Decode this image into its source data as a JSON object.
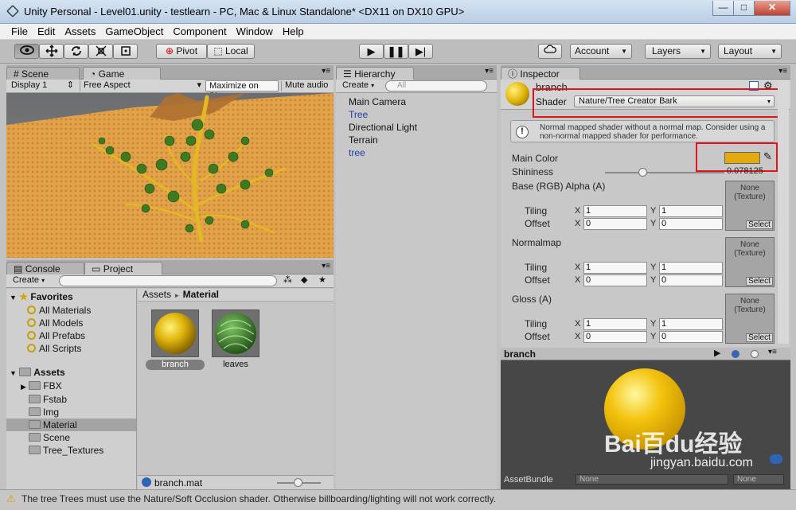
{
  "window": {
    "title": "Unity Personal - Level01.unity - testlearn - PC, Mac & Linux Standalone* <DX11 on DX10 GPU>",
    "btn_min": "—",
    "btn_max": "□",
    "btn_close": "✕"
  },
  "menu": [
    "File",
    "Edit",
    "Assets",
    "GameObject",
    "Component",
    "Window",
    "Help"
  ],
  "toolbar": {
    "pivot": "Pivot",
    "local": "Local",
    "account": "Account",
    "layers": "Layers",
    "layout": "Layout"
  },
  "scene_tabs": {
    "scene": "Scene",
    "game": "Game"
  },
  "game_bar": {
    "display": "Display 1",
    "aspect": "Free Aspect",
    "maximize": "Maximize on Play",
    "mute": "Mute audio"
  },
  "hierarchy": {
    "tab": "Hierarchy",
    "create": "Create",
    "search_placeholder": "All",
    "items": [
      "Main Camera",
      "Tree",
      "Directional Light",
      "Terrain",
      "tree"
    ]
  },
  "bottom_tabs": {
    "console": "Console",
    "project": "Project"
  },
  "project": {
    "create": "Create",
    "favorites_label": "Favorites",
    "favorites": [
      "All Materials",
      "All Models",
      "All Prefabs",
      "All Scripts"
    ],
    "assets_label": "Assets",
    "folders": [
      "FBX",
      "Fstab",
      "Img",
      "Material",
      "Scene",
      "Tree_Textures"
    ],
    "breadcrumb_root": "Assets",
    "breadcrumb_sep": "►",
    "breadcrumb_current": "Material",
    "assets": [
      "branch",
      "leaves"
    ],
    "selected_file": "branch.mat"
  },
  "inspector": {
    "tab": "Inspector",
    "object_name": "branch",
    "shader_label": "Shader",
    "shader_value": "Nature/Tree Creator Bark",
    "warning": "Normal mapped shader without a normal map. Consider using a non-normal mapped shader for performance.",
    "main_color_label": "Main Color",
    "main_color": "#e3a90d",
    "shininess_label": "Shininess",
    "shininess_value": "0.078125",
    "shininess_level": 0.078125,
    "textures": [
      {
        "label": "Base (RGB) Alpha (A)",
        "slot": "None\n(Texture)",
        "tiling_x": "1",
        "tiling_y": "1",
        "offset_x": "0",
        "offset_y": "0"
      },
      {
        "label": "Normalmap",
        "slot": "None\n(Texture)",
        "tiling_x": "1",
        "tiling_y": "1",
        "offset_x": "0",
        "offset_y": "0"
      },
      {
        "label": "Gloss (A)",
        "slot": "None\n(Texture)",
        "tiling_x": "1",
        "tiling_y": "1",
        "offset_x": "0",
        "offset_y": "0"
      }
    ],
    "tiling_label": "Tiling",
    "offset_label": "Offset",
    "x_label": "X",
    "y_label": "Y",
    "select_label": "Select",
    "preview_title": "branch",
    "assetbundle_label": "AssetBundle",
    "assetbundle_value": "None",
    "assetbundle_variant": "None"
  },
  "status": {
    "message": "The tree Trees must use the Nature/Soft Occlusion shader. Otherwise billboarding/lighting will not work correctly."
  },
  "watermark": {
    "text": "Bai百du经验",
    "url": "jingyan.baidu.com"
  },
  "colors": {
    "accent": "#3e6fb0",
    "highlight_red": "#e0151b",
    "material_yellow": "#e3b30c"
  }
}
